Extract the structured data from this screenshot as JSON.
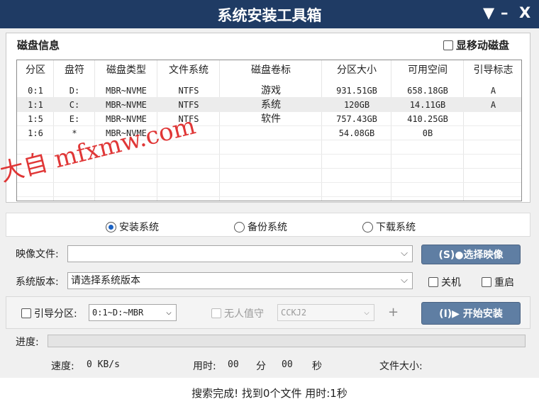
{
  "window": {
    "title": "系统安装工具箱",
    "menu_glyph": "▼",
    "minimize_glyph": "–",
    "close_glyph": "X"
  },
  "disk_panel": {
    "legend": "磁盘信息",
    "show_removable_label": "显移动磁盘",
    "columns": [
      "分区",
      "盘符",
      "磁盘类型",
      "文件系统",
      "磁盘卷标",
      "分区大小",
      "可用空间",
      "引导标志"
    ],
    "rows": [
      [
        "0:1",
        "D:",
        "MBR~NVME",
        "NTFS",
        "游戏",
        "931.51GB",
        "658.18GB",
        "A"
      ],
      [
        "1:1",
        "C:",
        "MBR~NVME",
        "NTFS",
        "系统",
        "120GB",
        "14.11GB",
        "A"
      ],
      [
        "1:5",
        "E:",
        "MBR~NVME",
        "NTFS",
        "软件",
        "757.43GB",
        "410.25GB",
        ""
      ],
      [
        "1:6",
        "*",
        "MBR~NVME",
        "",
        "",
        "54.08GB",
        "0B",
        ""
      ]
    ],
    "selected_row": 1
  },
  "modes": [
    {
      "label": "安装系统",
      "selected": true
    },
    {
      "label": "备份系统",
      "selected": false
    },
    {
      "label": "下载系统",
      "selected": false
    }
  ],
  "image_file": {
    "label": "映像文件:",
    "value": "",
    "button": "(S)●选择映像"
  },
  "version": {
    "label": "系统版本:",
    "value": "请选择系统版本",
    "shutdown_label": "关机",
    "restart_label": "重启"
  },
  "boot": {
    "label": "引导分区:",
    "value": "0:1~D:~MBR",
    "unattended_label": "无人值守",
    "key_value": "CCKJ2",
    "plus": "+",
    "install_button": "(I)▶ 开始安装"
  },
  "progress": {
    "label": "进度:",
    "value": 0
  },
  "stats": {
    "speed_label": "速度:",
    "speed_value": "0 KB/s",
    "time_label": "用时:",
    "minutes": "00",
    "min_unit": "分",
    "seconds": "00",
    "sec_unit": "秒",
    "size_label": "文件大小:"
  },
  "status": "搜索完成!  找到0个文件 用时:1秒",
  "watermark": "大自 mfxmw.com"
}
